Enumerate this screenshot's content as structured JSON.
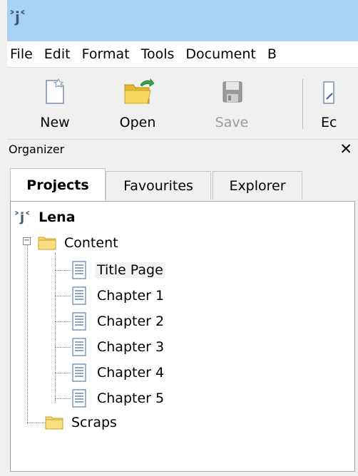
{
  "titlebar": {
    "app_icon_text": "˃j˂",
    "app_icon": "jotterpad-logo-icon"
  },
  "menu": {
    "items": [
      {
        "label": "File"
      },
      {
        "label": "Edit"
      },
      {
        "label": "Format"
      },
      {
        "label": "Tools"
      },
      {
        "label": "Document"
      },
      {
        "label": "B"
      }
    ]
  },
  "toolbar": {
    "new_label": "New",
    "open_label": "Open",
    "save_label": "Save",
    "partial_label": "Ec"
  },
  "organizer": {
    "title": "Organizer",
    "close_glyph": "✕",
    "tabs": [
      {
        "label": "Projects",
        "active": true
      },
      {
        "label": "Favourites",
        "active": false
      },
      {
        "label": "Explorer",
        "active": false
      }
    ],
    "tree": {
      "root": {
        "label": "Lena",
        "icon": "project-icon"
      },
      "content_folder": {
        "label": "Content",
        "expanded": true
      },
      "documents": [
        {
          "label": "Title Page",
          "selected": true
        },
        {
          "label": "Chapter 1"
        },
        {
          "label": "Chapter 2"
        },
        {
          "label": "Chapter 3"
        },
        {
          "label": "Chapter 4"
        },
        {
          "label": "Chapter 5"
        }
      ],
      "scraps_folder": {
        "label": "Scraps"
      }
    }
  },
  "colors": {
    "titlebar": "#a9d1f4",
    "folder_fill": "#f5d76e",
    "folder_edge": "#c9a227",
    "doc_blue": "#5b7fb5",
    "open_green": "#3aa348"
  }
}
